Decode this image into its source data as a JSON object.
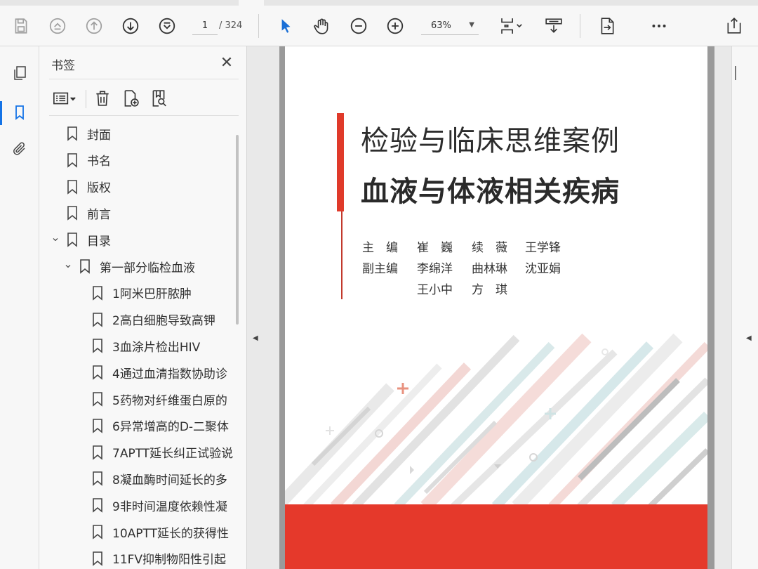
{
  "toolbar": {
    "current_page": "1",
    "total_pages": "/ 324",
    "zoom": "63%",
    "buttons": [
      "save-icon",
      "page-up-icon",
      "arrow-up-icon",
      "arrow-down-icon",
      "page-down-icon",
      "select-tool-icon",
      "hand-tool-icon",
      "zoom-out-icon",
      "zoom-in-icon",
      "page-fit-icon",
      "scroll-mode-icon",
      "extract-page-icon",
      "more-icon",
      "share-icon"
    ]
  },
  "left_rail": {
    "items": [
      "pages-icon",
      "bookmarks-icon",
      "attachments-icon"
    ],
    "active": "bookmarks-icon"
  },
  "bookmarks": {
    "title": "书签",
    "items": [
      {
        "label": "封面",
        "level": 0,
        "expanded": null
      },
      {
        "label": "书名",
        "level": 0,
        "expanded": null
      },
      {
        "label": "版权",
        "level": 0,
        "expanded": null
      },
      {
        "label": "前言",
        "level": 0,
        "expanded": null
      },
      {
        "label": "目录",
        "level": 0,
        "expanded": true
      },
      {
        "label": "第一部分临检血液",
        "level": 1,
        "expanded": true
      },
      {
        "label": "1阿米巴肝脓肿",
        "level": 2,
        "expanded": null
      },
      {
        "label": "2高白细胞导致高钾",
        "level": 2,
        "expanded": null
      },
      {
        "label": "3血涂片检出HIV",
        "level": 2,
        "expanded": null
      },
      {
        "label": "4通过血清指数协助诊",
        "level": 2,
        "expanded": null
      },
      {
        "label": "5药物对纤维蛋白原的",
        "level": 2,
        "expanded": null
      },
      {
        "label": "6异常增高的D-二聚体",
        "level": 2,
        "expanded": null
      },
      {
        "label": "7APTT延长纠正试验说",
        "level": 2,
        "expanded": null
      },
      {
        "label": "8凝血酶时间延长的多",
        "level": 2,
        "expanded": null
      },
      {
        "label": "9非时间温度依赖性凝",
        "level": 2,
        "expanded": null
      },
      {
        "label": "10APTT延长的获得性",
        "level": 2,
        "expanded": null
      },
      {
        "label": "11FV抑制物阳性引起",
        "level": 2,
        "expanded": null
      }
    ]
  },
  "document": {
    "title_line1": "检验与临床思维案例",
    "title_line2": "血液与体液相关疾病",
    "credits": [
      {
        "role": "主　编",
        "names": [
          "崔　巍",
          "续　薇",
          "王学锋"
        ]
      },
      {
        "role": "副主编",
        "names": [
          "李绵洋",
          "曲林琳",
          "沈亚娟"
        ]
      },
      {
        "role": "",
        "names": [
          "王小中",
          "方　琪",
          ""
        ]
      }
    ],
    "accent_color": "#e5392b"
  }
}
